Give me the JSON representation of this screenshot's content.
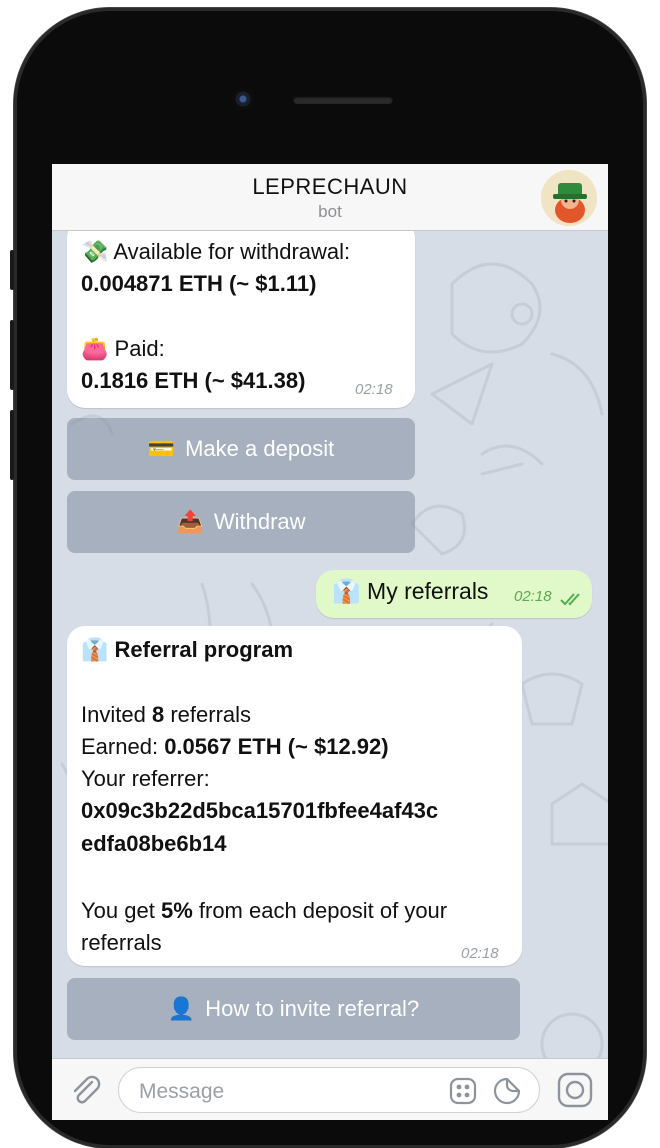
{
  "chat": {
    "title": "LEPRECHAUN",
    "subtitle": "bot"
  },
  "balance_message": {
    "available_emoji": "💸",
    "available_label": "Available for withdrawal:",
    "available_value": "0.004871 ETH (~ $1.11)",
    "paid_emoji": "👛",
    "paid_label": "Paid:",
    "paid_value": "0.1816 ETH (~ $41.38)",
    "time": "02:18"
  },
  "buttons": {
    "deposit_emoji": "💳",
    "deposit": "Make a deposit",
    "withdraw_emoji": "📤",
    "withdraw": "Withdraw",
    "invite_emoji": "👤",
    "invite": "How to invite referral?"
  },
  "outgoing": {
    "emoji": "👔",
    "text": "My referrals",
    "time": "02:18",
    "status": "read"
  },
  "referral_message": {
    "emoji": "👔",
    "heading": "Referral program",
    "invited_pre": "Invited",
    "invited_count": "8",
    "invited_post": "referrals",
    "earned_label": "Earned:",
    "earned_value": "0.0567 ETH (~ $12.92)",
    "referrer_label": "Your referrer:",
    "referrer_line1": "0x09c3b22d5bca15701fbfee4af43c",
    "referrer_line2": "edfa08be6b14",
    "get_pre": "You get",
    "get_percent": "5%",
    "get_post": "from each deposit of your",
    "get_line2": "referrals",
    "time": "02:18"
  },
  "input": {
    "placeholder": "Message"
  },
  "colors": {
    "outgoing_bubble": "#e1f9c8",
    "read_check": "#4fae4e",
    "bot_button": "#8894a6"
  }
}
